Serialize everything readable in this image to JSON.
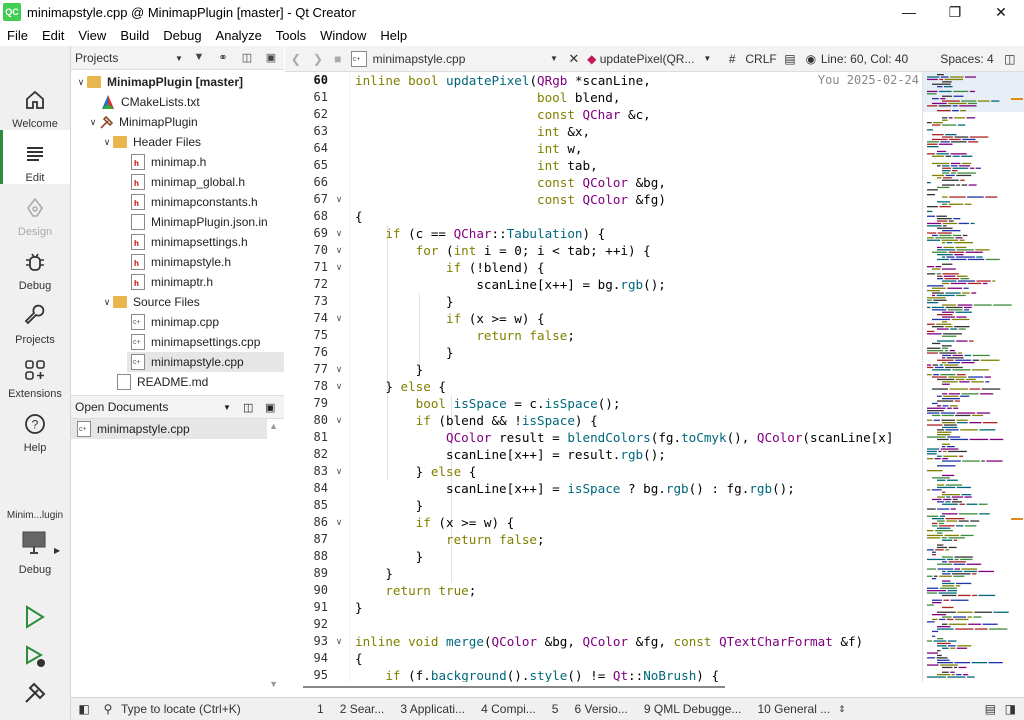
{
  "window": {
    "title": "minimapstyle.cpp @ MinimapPlugin [master] - Qt Creator",
    "app_icon": "QC"
  },
  "menu": [
    "File",
    "Edit",
    "View",
    "Build",
    "Debug",
    "Analyze",
    "Tools",
    "Window",
    "Help"
  ],
  "modes": {
    "welcome": "Welcome",
    "edit": "Edit",
    "design": "Design",
    "debug": "Debug",
    "projects": "Projects",
    "extensions": "Extensions",
    "help": "Help",
    "kit_name": "Minim...lugin",
    "kit_mode": "Debug"
  },
  "projects_pane": {
    "title": "Projects",
    "tree": [
      {
        "label": "MinimapPlugin [master]",
        "bold": true
      },
      {
        "label": "CMakeLists.txt"
      },
      {
        "label": "MinimapPlugin"
      },
      {
        "label": "Header Files"
      },
      {
        "label": "minimap.h"
      },
      {
        "label": "minimap_global.h"
      },
      {
        "label": "minimapconstants.h"
      },
      {
        "label": "MinimapPlugin.json.in"
      },
      {
        "label": "minimapsettings.h"
      },
      {
        "label": "minimapstyle.h"
      },
      {
        "label": "minimaptr.h"
      },
      {
        "label": "Source Files"
      },
      {
        "label": "minimap.cpp"
      },
      {
        "label": "minimapsettings.cpp"
      },
      {
        "label": "minimapstyle.cpp"
      },
      {
        "label": "README.md"
      }
    ]
  },
  "open_documents": {
    "title": "Open Documents",
    "items": [
      "minimapstyle.cpp"
    ]
  },
  "editor_toolbar": {
    "file": "minimapstyle.cpp",
    "symbol": "updatePixel(QR...",
    "hash": "#",
    "line_ending": "CRLF",
    "position": "Line: 60, Col: 40",
    "indent": "Spaces: 4"
  },
  "editor": {
    "blame": "You 2025-02-24",
    "line_numbers": [
      "60",
      "61",
      "62",
      "63",
      "64",
      "65",
      "66",
      "67",
      "68",
      "69",
      "70",
      "71",
      "72",
      "73",
      "74",
      "75",
      "76",
      "77",
      "78",
      "79",
      "80",
      "81",
      "82",
      "83",
      "84",
      "85",
      "86",
      "87",
      "88",
      "89",
      "90",
      "91",
      "92",
      "93",
      "94",
      "95"
    ],
    "lines": [
      "inline bool updatePixel(QRgb *scanLine,",
      "                        bool blend,",
      "                        const QChar &c,",
      "                        int &x,",
      "                        int w,",
      "                        int tab,",
      "                        const QColor &bg,",
      "                        const QColor &fg)",
      "{",
      "    if (c == QChar::Tabulation) {",
      "        for (int i = 0; i < tab; ++i) {",
      "            if (!blend) {",
      "                scanLine[x++] = bg.rgb();",
      "            }",
      "            if (x >= w) {",
      "                return false;",
      "            }",
      "        }",
      "    } else {",
      "        bool isSpace = c.isSpace();",
      "        if (blend && !isSpace) {",
      "            QColor result = blendColors(fg.toCmyk(), QColor(scanLine[x]",
      "            scanLine[x++] = result.rgb();",
      "        } else {",
      "            scanLine[x++] = isSpace ? bg.rgb() : fg.rgb();",
      "        }",
      "        if (x >= w) {",
      "            return false;",
      "        }",
      "    }",
      "    return true;",
      "}",
      "",
      "inline void merge(QColor &bg, QColor &fg, const QTextCharFormat &f)",
      "{",
      "    if (f.background().style() != Qt::NoBrush) {"
    ]
  },
  "statusbar": {
    "locator_placeholder": "Type to locate (Ctrl+K)",
    "tabs": [
      "1",
      "2  Sear...",
      "3  Applicati...",
      "4  Compi...",
      "5",
      "6  Versio...",
      "9  QML Debugge...",
      "10  General ..."
    ]
  },
  "colors": {
    "accent": "#2d8c3c",
    "keyword": "#808000",
    "type": "#800080",
    "function": "#00677c"
  }
}
